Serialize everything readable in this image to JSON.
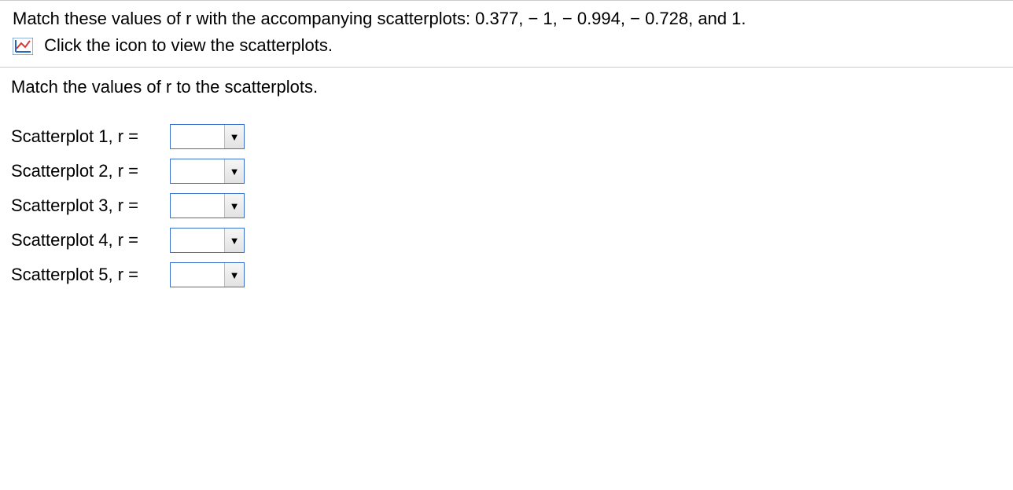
{
  "question": {
    "prompt": "Match these values of r with the accompanying scatterplots: 0.377,  − 1,  − 0.994,  − 0.728, and 1.",
    "icon_instruction": "Click the icon to view the scatterplots."
  },
  "body": {
    "instruction": "Match the values of r to the scatterplots.",
    "rows": [
      {
        "label": "Scatterplot 1, r =",
        "value": ""
      },
      {
        "label": "Scatterplot 2, r =",
        "value": ""
      },
      {
        "label": "Scatterplot 3, r =",
        "value": ""
      },
      {
        "label": "Scatterplot 4, r =",
        "value": ""
      },
      {
        "label": "Scatterplot 5, r =",
        "value": ""
      }
    ]
  }
}
